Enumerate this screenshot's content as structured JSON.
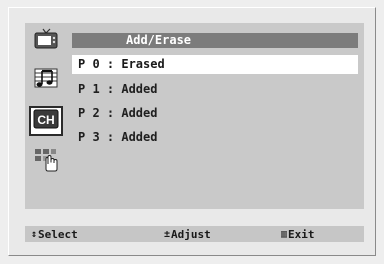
{
  "menu": {
    "title": "Add/Erase",
    "selected_index": 0,
    "channels": [
      {
        "label": "P 0 : Erased"
      },
      {
        "label": "P 1 : Added"
      },
      {
        "label": "P 2 : Added"
      },
      {
        "label": "P 3 : Added"
      }
    ]
  },
  "sidebar": {
    "icons": [
      {
        "name": "picture-icon",
        "selected": false
      },
      {
        "name": "sound-icon",
        "selected": false
      },
      {
        "name": "channel-icon",
        "label": "CH",
        "selected": true
      },
      {
        "name": "setup-icon",
        "selected": false
      }
    ]
  },
  "footer": {
    "hints": [
      {
        "glyph": "↕",
        "label": "Select"
      },
      {
        "glyph": "±",
        "label": "Adjust"
      },
      {
        "glyph": "▥",
        "label": "Exit"
      }
    ]
  },
  "colors": {
    "background": "#eeeeee",
    "panel": "#c9c9c9",
    "title_bar": "#7c7c7c",
    "highlight": "#ffffff",
    "text": "#1f1f1f"
  }
}
